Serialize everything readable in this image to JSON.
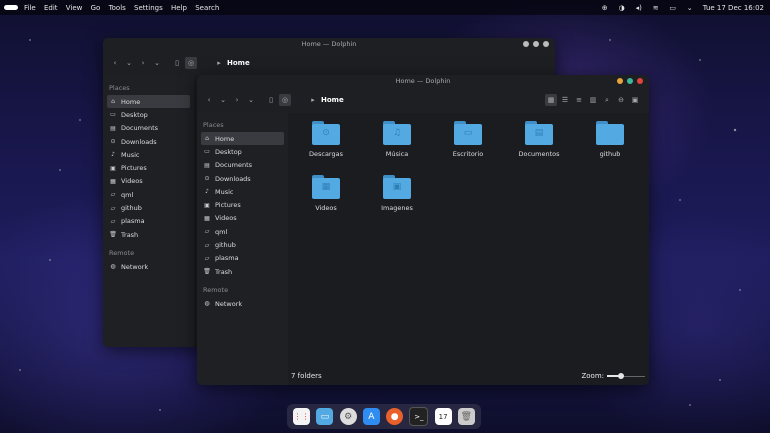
{
  "topbar": {
    "menus": [
      "File",
      "Edit",
      "View",
      "Go",
      "Tools",
      "Settings",
      "Help",
      "Search"
    ],
    "datetime": "Tue 17 Dec 16:02"
  },
  "back_window": {
    "title": "Home — Dolphin",
    "breadcrumb": "Home",
    "places_header": "Places",
    "places": [
      "Home",
      "Desktop",
      "Documents",
      "Downloads",
      "Music",
      "Pictures",
      "Videos",
      "qml",
      "github",
      "plasma",
      "Trash"
    ],
    "remote_header": "Remote",
    "remote": [
      "Network"
    ]
  },
  "front_window": {
    "title": "Home — Dolphin",
    "breadcrumb": "Home",
    "places_header": "Places",
    "places": [
      "Home",
      "Desktop",
      "Documents",
      "Downloads",
      "Music",
      "Pictures",
      "Videos",
      "qml",
      "github",
      "plasma",
      "Trash"
    ],
    "remote_header": "Remote",
    "remote": [
      "Network"
    ],
    "folders": [
      "Descargas",
      "Música",
      "Escritorio",
      "Documentos",
      "github",
      "Videos",
      "Imagenes"
    ],
    "status": "7 folders",
    "zoom_label": "Zoom:",
    "zoom_level": 0.35
  },
  "colors": {
    "accent": "#53a9e2",
    "close": "#e0443e",
    "minimize": "#e8a33a",
    "maximize": "#3cb89a"
  }
}
